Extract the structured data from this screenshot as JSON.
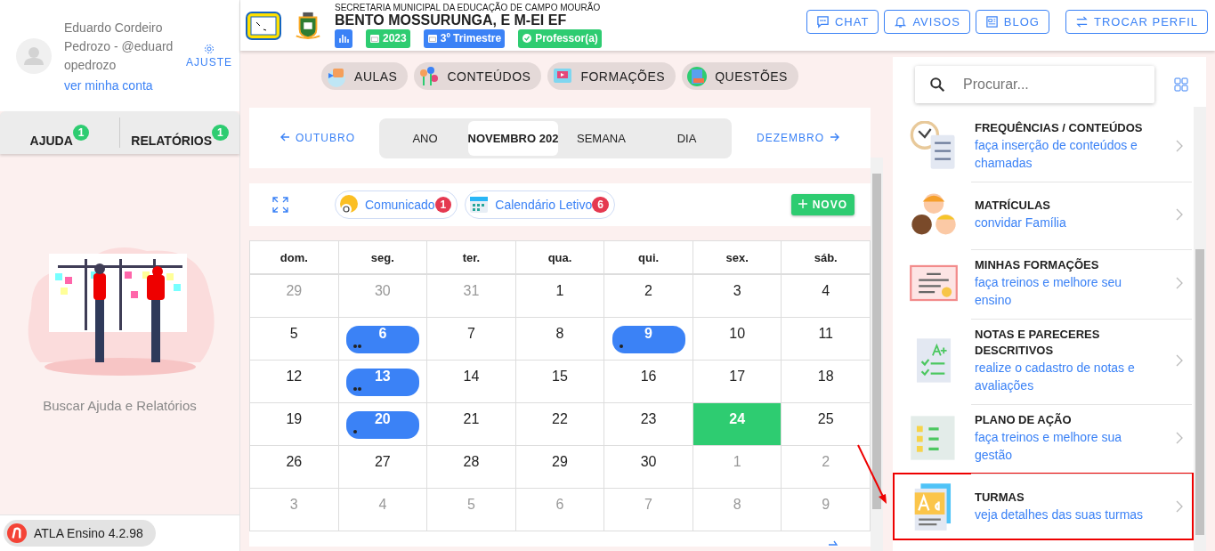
{
  "user": {
    "name": "Eduardo Cordeiro Pedrozo - @eduardopedrozo",
    "account_link": "ver minha conta",
    "settings_label": "AJUSTE"
  },
  "side_tabs": [
    {
      "label": "AJUDA",
      "badge": "1"
    },
    {
      "label": "RELATÓRIOS",
      "badge": "1"
    }
  ],
  "side_caption": "Buscar Ajuda e Relatórios",
  "version": "ATLA Ensino 4.2.98",
  "header": {
    "secretariat": "SECRETARIA MUNICIPAL DA EDUCAÇÃO DE CAMPO MOURÃO",
    "school": "BENTO MOSSURUNGA, E M-EI EF",
    "chips": [
      {
        "kind": "stats",
        "color": "#3b82f6"
      },
      {
        "kind": "calendar",
        "label": "2023",
        "color": "#2ecc71"
      },
      {
        "kind": "calendar",
        "label": "3º Trimestre",
        "color": "#3b82f6"
      },
      {
        "kind": "check",
        "label": "Professor(a)",
        "color": "#2ecc71"
      }
    ],
    "buttons": [
      {
        "kind": "chat",
        "label": "CHAT"
      },
      {
        "kind": "bell",
        "label": "AVISOS"
      },
      {
        "kind": "news",
        "label": "BLOG"
      },
      {
        "kind": "swap",
        "label": "TROCAR PERFIL"
      }
    ]
  },
  "nav": [
    {
      "kind": "aulas",
      "label": "AULAS"
    },
    {
      "kind": "conteudos",
      "label": "CONTEÚDOS"
    },
    {
      "kind": "formacoes",
      "label": "FORMAÇÕES"
    },
    {
      "kind": "questoes",
      "label": "QUESTÕES"
    }
  ],
  "calendar": {
    "prev": "OUTUBRO",
    "next": "DEZEMBRO",
    "views": [
      {
        "label": "ANO",
        "selected": false
      },
      {
        "label": "NOVEMBRO 202",
        "selected": true
      },
      {
        "label": "SEMANA",
        "selected": false
      },
      {
        "label": "DIA",
        "selected": false
      }
    ],
    "filters": [
      {
        "kind": "mail",
        "label": "Comunicado",
        "count": "1"
      },
      {
        "kind": "calendar",
        "label": "Calendário Letivo",
        "count": "6"
      }
    ],
    "new_button": "NOVO",
    "weekdays": [
      "dom.",
      "seg.",
      "ter.",
      "qua.",
      "qui.",
      "sex.",
      "sáb."
    ],
    "weeks": [
      [
        {
          "day": "29",
          "kind": "muted"
        },
        {
          "day": "30",
          "kind": "muted"
        },
        {
          "day": "31",
          "kind": "muted"
        },
        {
          "day": "1",
          "kind": "plain"
        },
        {
          "day": "2",
          "kind": "plain"
        },
        {
          "day": "3",
          "kind": "plain"
        },
        {
          "day": "4",
          "kind": "plain"
        }
      ],
      [
        {
          "day": "5",
          "kind": "plain"
        },
        {
          "day": "6",
          "kind": "event",
          "markers": [
            {
              "kind": "dot"
            },
            {
              "kind": "dot"
            }
          ]
        },
        {
          "day": "7",
          "kind": "plain"
        },
        {
          "day": "8",
          "kind": "plain"
        },
        {
          "day": "9",
          "kind": "event",
          "markers": [
            {
              "kind": "dot"
            }
          ]
        },
        {
          "day": "10",
          "kind": "plain"
        },
        {
          "day": "11",
          "kind": "plain"
        }
      ],
      [
        {
          "day": "12",
          "kind": "plain"
        },
        {
          "day": "13",
          "kind": "event",
          "markers": [
            {
              "kind": "dot"
            },
            {
              "kind": "dot"
            }
          ]
        },
        {
          "day": "14",
          "kind": "plain"
        },
        {
          "day": "15",
          "kind": "plain"
        },
        {
          "day": "16",
          "kind": "plain"
        },
        {
          "day": "17",
          "kind": "plain"
        },
        {
          "day": "18",
          "kind": "plain"
        }
      ],
      [
        {
          "day": "19",
          "kind": "plain"
        },
        {
          "day": "20",
          "kind": "event",
          "markers": [
            {
              "kind": "dot"
            }
          ]
        },
        {
          "day": "21",
          "kind": "plain"
        },
        {
          "day": "22",
          "kind": "plain"
        },
        {
          "day": "23",
          "kind": "plain"
        },
        {
          "day": "24",
          "kind": "today"
        },
        {
          "day": "25",
          "kind": "plain"
        }
      ],
      [
        {
          "day": "26",
          "kind": "plain"
        },
        {
          "day": "27",
          "kind": "plain"
        },
        {
          "day": "28",
          "kind": "plain"
        },
        {
          "day": "29",
          "kind": "plain"
        },
        {
          "day": "30",
          "kind": "plain"
        },
        {
          "day": "1",
          "kind": "muted"
        },
        {
          "day": "2",
          "kind": "muted"
        }
      ],
      [
        {
          "day": "3",
          "kind": "muted"
        },
        {
          "day": "4",
          "kind": "muted"
        },
        {
          "day": "5",
          "kind": "muted"
        },
        {
          "day": "6",
          "kind": "muted"
        },
        {
          "day": "7",
          "kind": "muted"
        },
        {
          "day": "8",
          "kind": "muted"
        },
        {
          "day": "9",
          "kind": "muted"
        }
      ]
    ]
  },
  "search": {
    "placeholder": "Procurar..."
  },
  "menu": [
    {
      "kind": "clock",
      "title": "FREQUÊNCIAS / CONTEÚDOS",
      "subtitle": "faça inserção de conteúdos e chamadas",
      "highlighted": false
    },
    {
      "kind": "kids",
      "title": "MATRÍCULAS",
      "subtitle": "convidar Família",
      "highlighted": false
    },
    {
      "kind": "certificate",
      "title": "MINHAS FORMAÇÕES",
      "subtitle": "faça treinos e melhore seu ensino",
      "highlighted": false
    },
    {
      "kind": "grades",
      "title": "NOTAS E PARECERES DESCRITIVOS",
      "subtitle": "realize o cadastro de notas e avaliações",
      "highlighted": false
    },
    {
      "kind": "plan",
      "title": "PLANO DE AÇÃO",
      "subtitle": "faça treinos e melhore sua gestão",
      "highlighted": false
    },
    {
      "kind": "classes",
      "title": "TURMAS",
      "subtitle": "veja detalhes das suas turmas",
      "highlighted": true
    }
  ]
}
